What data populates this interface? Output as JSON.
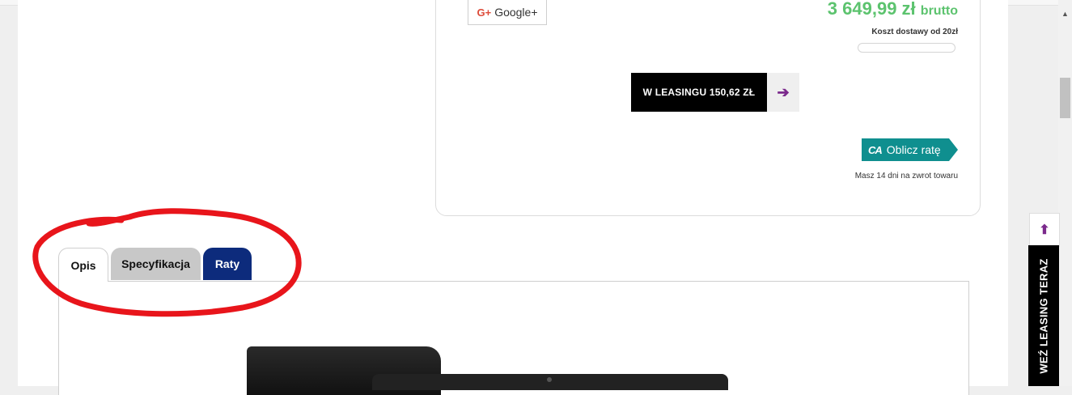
{
  "share": {
    "google_plus_label": "Google+",
    "google_plus_icon": "G+"
  },
  "price": {
    "amount": "3 649,99 zł",
    "suffix": "brutto",
    "delivery": "Koszt dostawy od 20zł",
    "color": "#5cc36e"
  },
  "leasing": {
    "button_label": "W LEASINGU 150,62 ZŁ",
    "arrow_icon": "arrow-right-icon"
  },
  "installment": {
    "button_label": "Oblicz ratę",
    "logo_text": "CA"
  },
  "returns_note": "Masz 14 dni na zwrot towaru",
  "tabs": [
    {
      "label": "Opis",
      "active": true
    },
    {
      "label": "Specyfikacja",
      "active": false
    },
    {
      "label": "Raty",
      "active": false
    }
  ],
  "side_panel": {
    "label": "WEŹ LEASING TERAZ",
    "scroll_up_icon": "arrow-up-icon"
  },
  "colors": {
    "accent_purple": "#7b2a8c",
    "raty_tab": "#0d2b7c",
    "rate_button": "#0f8f8f",
    "annotation": "#e8151b"
  }
}
